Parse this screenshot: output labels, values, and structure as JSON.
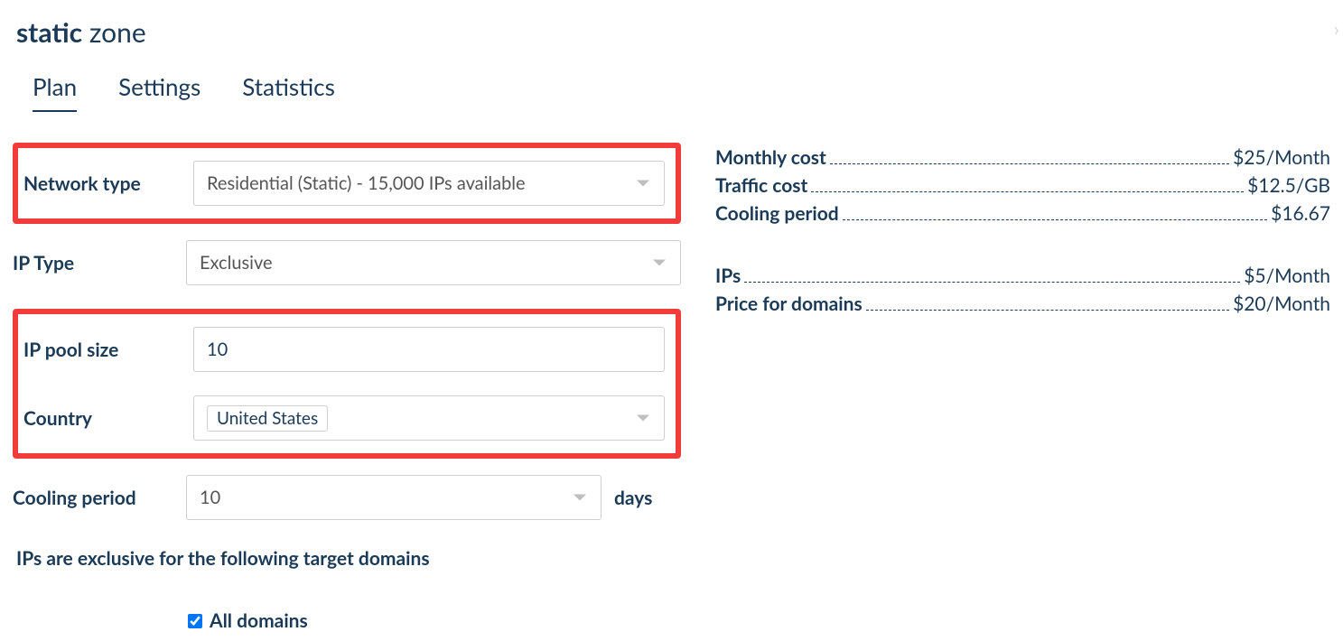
{
  "title": {
    "bold": "static",
    "rest": "zone"
  },
  "tabs": {
    "plan": "Plan",
    "settings": "Settings",
    "statistics": "Statistics"
  },
  "form": {
    "network_type": {
      "label": "Network type",
      "value": "Residential (Static) - 15,000 IPs available"
    },
    "ip_type": {
      "label": "IP Type",
      "value": "Exclusive"
    },
    "pool_size": {
      "label": "IP pool size",
      "value": "10"
    },
    "country": {
      "label": "Country",
      "value": "United States"
    },
    "cooling": {
      "label": "Cooling period",
      "value": "10",
      "unit": "days"
    }
  },
  "domains_heading": "IPs are exclusive for the following target domains",
  "all_domains_label": "All domains",
  "prices": {
    "monthly": {
      "label": "Monthly cost",
      "value": "$25/Month"
    },
    "traffic": {
      "label": "Traffic cost",
      "value": "$12.5/GB"
    },
    "cooling": {
      "label": "Cooling period",
      "value": "$16.67"
    },
    "ips": {
      "label": "IPs",
      "value": "$5/Month"
    },
    "domains": {
      "label": "Price for domains",
      "value": "$20/Month"
    }
  }
}
